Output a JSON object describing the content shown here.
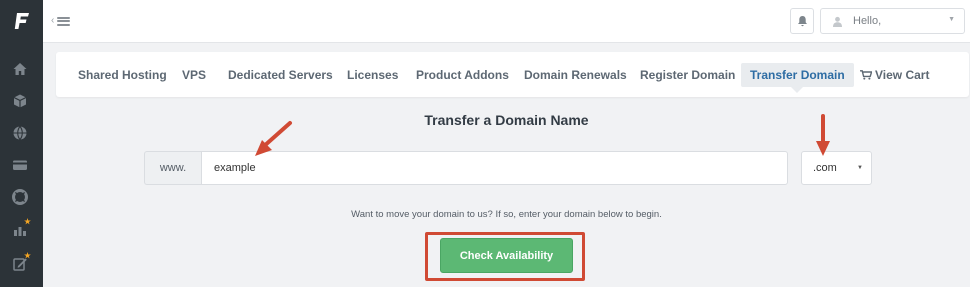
{
  "sidebar": {
    "logo_icon": "brand-logo-icon",
    "items": [
      {
        "icon": "home-icon"
      },
      {
        "icon": "cube-icon"
      },
      {
        "icon": "globe-icon"
      },
      {
        "icon": "credit-card-icon"
      },
      {
        "icon": "lifebuoy-icon"
      },
      {
        "icon": "reports-icon",
        "starred": true
      },
      {
        "icon": "edit-icon",
        "starred": true
      }
    ]
  },
  "topbar": {
    "user_greeting": "Hello,"
  },
  "nav": {
    "items": [
      {
        "label": "Shared Hosting"
      },
      {
        "label": "VPS"
      },
      {
        "label": "Dedicated Servers"
      },
      {
        "label": "Licenses"
      },
      {
        "label": "Product Addons"
      },
      {
        "label": "Domain Renewals"
      },
      {
        "label": "Register Domain"
      },
      {
        "label": "Transfer Domain",
        "active": true
      },
      {
        "label": "View Cart"
      }
    ]
  },
  "transfer": {
    "title": "Transfer a Domain Name",
    "prefix": "www.",
    "domain_value": "example",
    "tld_value": ".com",
    "info_text": "Want to move your domain to us? If so, enter your domain below to begin.",
    "button_label": "Check Availability"
  },
  "colors": {
    "sidebar_bg": "#2c3338",
    "active_tab_text": "#2e6da4",
    "button_green": "#5cb874",
    "annotation_red": "#d04a34"
  }
}
